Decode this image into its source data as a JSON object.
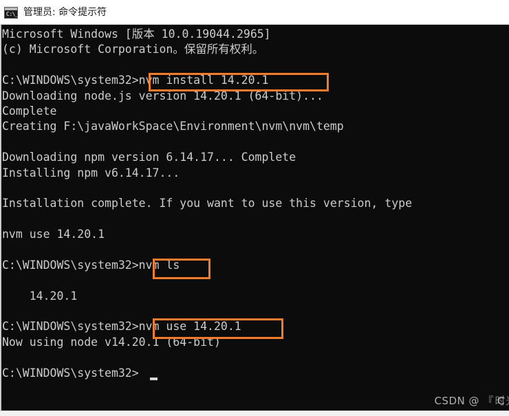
{
  "window": {
    "title": "管理员: 命令提示符",
    "icon": "cmd-console-icon",
    "icon_glyph": "C:\\_"
  },
  "colors": {
    "console_background": "#0c0c0c",
    "console_text": "#cccccc",
    "highlight_border": "#f07c2c",
    "titlebar_background": "#ffffff",
    "title_text": "#1a1a1a"
  },
  "console": {
    "lines": [
      "Microsoft Windows [版本 10.0.19044.2965]",
      "(c) Microsoft Corporation。保留所有权利。",
      "",
      "C:\\WINDOWS\\system32>nvm install 14.20.1",
      "Downloading node.js version 14.20.1 (64-bit)...",
      "Complete",
      "Creating F:\\javaWorkSpace\\Environment\\nvm\\nvm\\temp",
      "",
      "Downloading npm version 6.14.17... Complete",
      "Installing npm v6.14.17...",
      "",
      "Installation complete. If you want to use this version, type",
      "",
      "nvm use 14.20.1",
      "",
      "C:\\WINDOWS\\system32>nvm ls",
      "",
      "    14.20.1",
      "",
      "C:\\WINDOWS\\system32>nvm use 14.20.1",
      "Now using node v14.20.1 (64-bit)",
      "",
      "C:\\WINDOWS\\system32>"
    ],
    "prompt": "C:\\WINDOWS\\system32>",
    "commands": [
      "nvm install 14.20.1",
      "nvm ls",
      "nvm use 14.20.1"
    ],
    "node_version": "14.20.1",
    "npm_version": "6.14.17",
    "architecture": "64-bit",
    "nvm_install_path": "F:\\javaWorkSpace\\Environment\\nvm\\nvm\\temp"
  },
  "watermark": {
    "prefix": "CSDN @ 『 C",
    "overlay": "时光框萌 』"
  }
}
